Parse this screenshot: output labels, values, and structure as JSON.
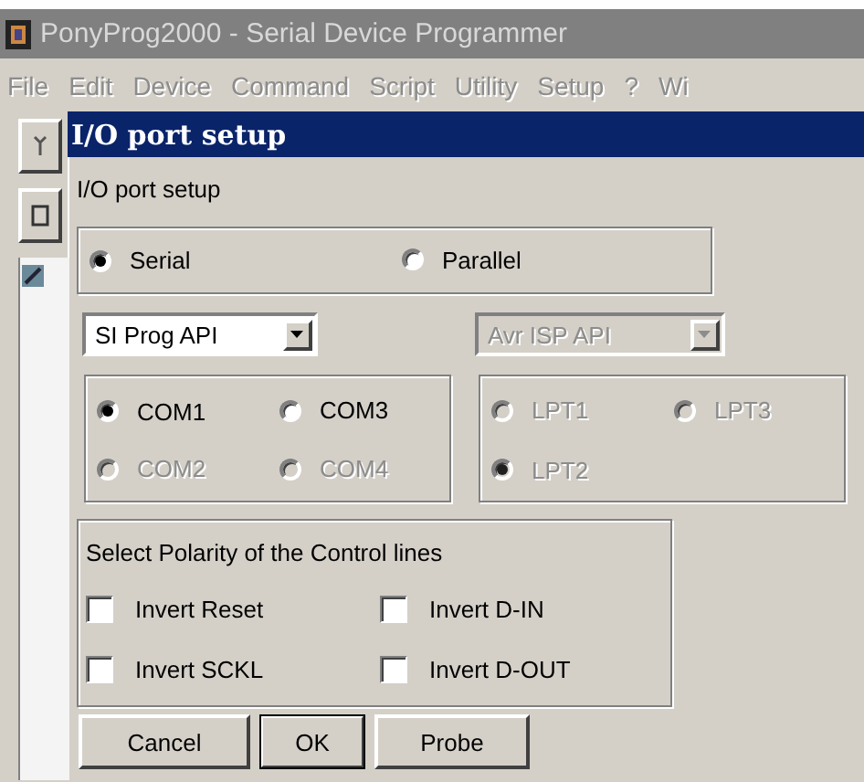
{
  "app": {
    "title": "PonyProg2000 - Serial Device Programmer",
    "menu": [
      "File",
      "Edit",
      "Device",
      "Command",
      "Script",
      "Utility",
      "Setup",
      "?",
      "Wi"
    ]
  },
  "dialog": {
    "title": "I/O port setup",
    "heading": "I/O port setup",
    "interfaces": [
      {
        "label": "Serial",
        "selected": true
      },
      {
        "label": "Parallel",
        "selected": false
      }
    ],
    "serial_api": {
      "value": "SI Prog API",
      "disabled": false
    },
    "parallel_api": {
      "value": "Avr ISP API",
      "disabled": true
    },
    "com_ports": [
      {
        "label": "COM1",
        "selected": true,
        "disabled": false
      },
      {
        "label": "COM3",
        "selected": false,
        "disabled": false
      },
      {
        "label": "COM2",
        "selected": false,
        "disabled": true
      },
      {
        "label": "COM4",
        "selected": false,
        "disabled": true
      }
    ],
    "lpt_ports": [
      {
        "label": "LPT1",
        "selected": false,
        "disabled": true
      },
      {
        "label": "LPT3",
        "selected": false,
        "disabled": true
      },
      {
        "label": "LPT2",
        "selected": true,
        "disabled": true
      }
    ],
    "polarity": {
      "title": "Select Polarity of the Control lines",
      "options": [
        {
          "label": "Invert Reset",
          "checked": false
        },
        {
          "label": "Invert D-IN",
          "checked": false
        },
        {
          "label": "Invert SCKL",
          "checked": false
        },
        {
          "label": "Invert D-OUT",
          "checked": false
        }
      ]
    },
    "buttons": [
      {
        "label": "Cancel",
        "default": false
      },
      {
        "label": "OK",
        "default": true
      },
      {
        "label": "Probe",
        "default": false
      }
    ]
  }
}
